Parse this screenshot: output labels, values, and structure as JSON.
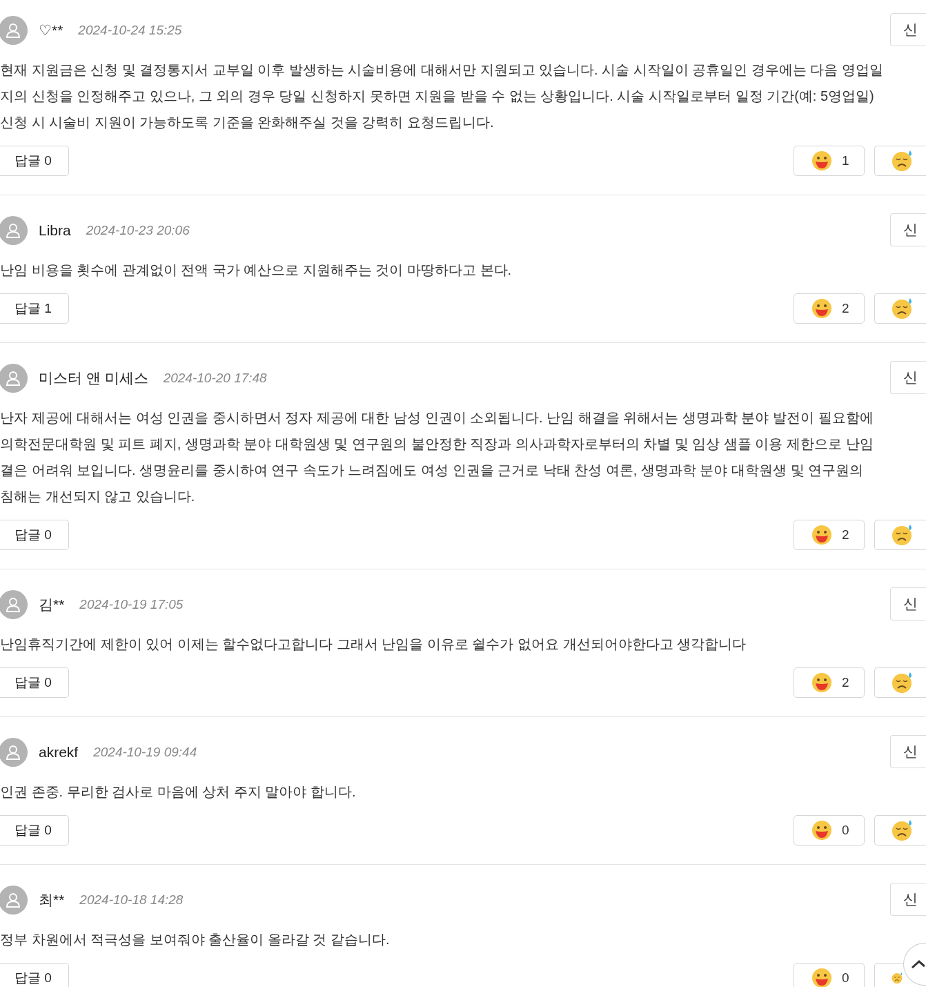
{
  "comments": [
    {
      "author": "♡**",
      "date": "2024-10-24 15:25",
      "report": "신",
      "lines": [
        "현재 지원금은 신청 및 결정통지서 교부일 이후 발생하는 시술비용에 대해서만 지원되고 있습니다. 시술 시작일이 공휴일인 경우에는 다음 영업일",
        "지의 신청을 인정해주고 있으나, 그 외의 경우 당일 신청하지 못하면 지원을 받을 수 없는 상황입니다. 시술 시작일로부터 일정 기간(예: 5영업일)",
        "신청 시 시술비 지원이 가능하도록 기준을 완화해주실 것을 강력히 요청드립니다."
      ],
      "reply": "답글 0",
      "likes": "1"
    },
    {
      "author": "Libra",
      "date": "2024-10-23 20:06",
      "report": "신",
      "lines": [
        "난임 비용을 횟수에 관계없이 전액 국가 예산으로 지원해주는 것이 마땅하다고 본다."
      ],
      "reply": "답글 1",
      "likes": "2"
    },
    {
      "author": "미스터 앤 미세스",
      "date": "2024-10-20 17:48",
      "report": "신",
      "lines": [
        "난자 제공에 대해서는 여성 인권을 중시하면서 정자 제공에 대한 남성 인권이 소외됩니다. 난임 해결을 위해서는 생명과학 분야 발전이 필요함에",
        "의학전문대학원 및 피트 폐지, 생명과학 분야 대학원생 및 연구원의 불안정한 직장과 의사과학자로부터의 차별 및 임상 샘플 이용 제한으로 난임",
        "결은 어려워 보입니다. 생명윤리를 중시하여 연구 속도가 느려짐에도 여성 인권을 근거로 낙태 찬성 여론, 생명과학 분야 대학원생 및 연구원의",
        "침해는 개선되지 않고 있습니다."
      ],
      "reply": "답글 0",
      "likes": "2"
    },
    {
      "author": "김**",
      "date": "2024-10-19 17:05",
      "report": "신",
      "lines": [
        "난임휴직기간에 제한이 있어 이제는 할수없다고합니다 그래서 난임을 이유로 쉴수가 없어요 개선되어야한다고 생각합니다"
      ],
      "reply": "답글 0",
      "likes": "2"
    },
    {
      "author": "akrekf",
      "date": "2024-10-19 09:44",
      "report": "신",
      "lines": [
        "인권 존중. 무리한 검사로 마음에 상처 주지 말아야 합니다."
      ],
      "reply": "답글 0",
      "likes": "0"
    },
    {
      "author": "최**",
      "date": "2024-10-18 14:28",
      "report": "신",
      "lines": [
        "정부 차원에서 적극성을 보여줘야 출산율이 올라갈 것 같습니다."
      ],
      "reply": "답글 0",
      "likes": "0"
    }
  ]
}
